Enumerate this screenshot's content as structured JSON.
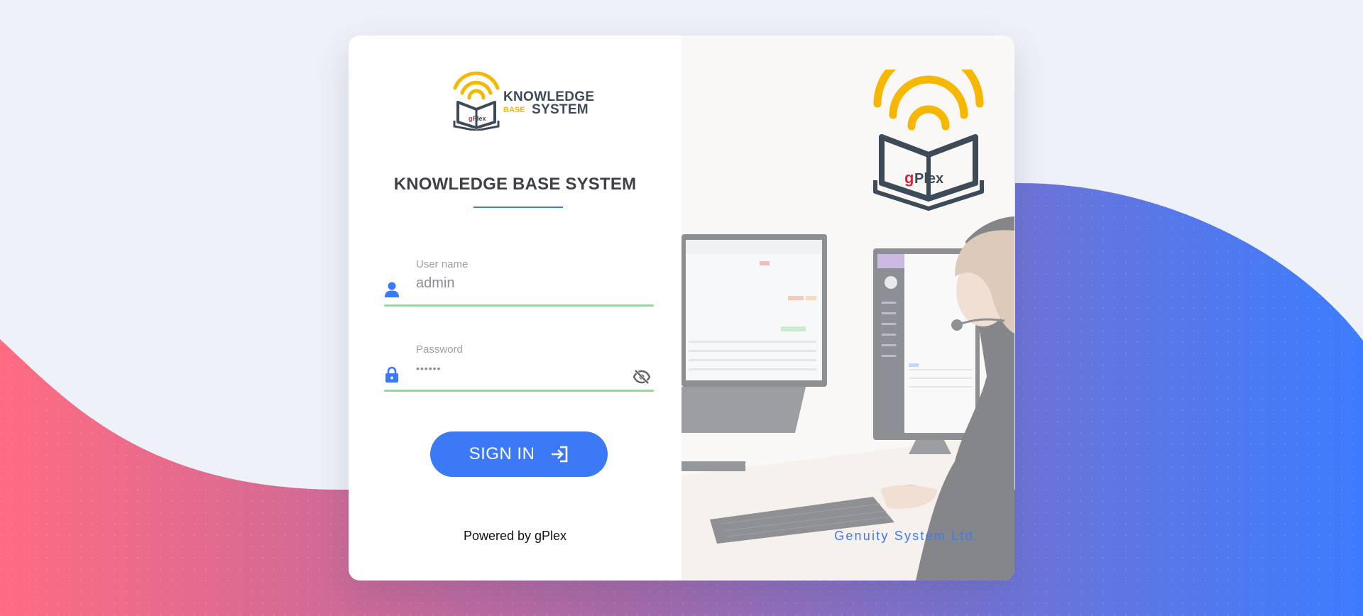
{
  "brand": {
    "logo_word_1": "KNOWLEDGE",
    "logo_word_base": "BASE",
    "logo_word_2": "SYSTEM",
    "logo_mark_text": "gPlex"
  },
  "title": "KNOWLEDGE BASE SYSTEM",
  "form": {
    "username": {
      "label": "User name",
      "value": "admin"
    },
    "password": {
      "label": "Password",
      "value": "••••••"
    },
    "sign_in_label": "SIGN IN"
  },
  "footer": {
    "powered_by": "Powered by gPlex",
    "company": "Genuity System Ltd."
  },
  "colors": {
    "accent": "#3b79f7",
    "field_valid": "#86e28f",
    "logo_yellow": "#f5b700",
    "logo_dark": "#3d4a58",
    "logo_red": "#d9233a"
  },
  "icons": {
    "username": "person-icon",
    "password": "lock-icon",
    "visibility": "eye-off-icon",
    "sign_in": "login-arrow-icon"
  }
}
